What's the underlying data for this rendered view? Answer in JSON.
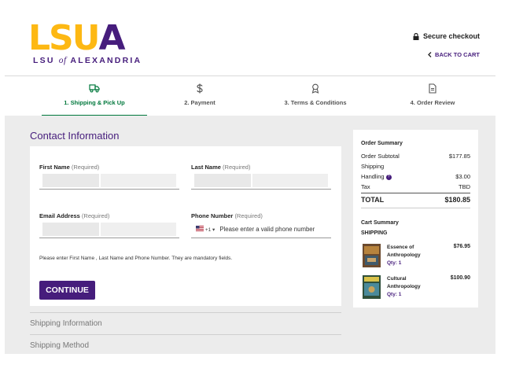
{
  "brand": {
    "logo_letters": [
      "L",
      "S",
      "U",
      "A"
    ],
    "logo_letter_colors": [
      "#fdb813",
      "#fdb813",
      "#fdb813",
      "#461d7c"
    ],
    "sub_left": "LSU",
    "sub_of": "of",
    "sub_right": "ALEXANDRIA",
    "primary_color": "#461d7c",
    "gold_color": "#fdb813",
    "success_color": "#00783c"
  },
  "header": {
    "secure_label": "Secure checkout",
    "secure_icon": "lock-icon",
    "back_label": "BACK TO CART",
    "back_icon": "chevron-left-icon"
  },
  "steps": [
    {
      "label": "1. Shipping & Pick Up",
      "icon": "truck-icon",
      "active": true
    },
    {
      "label": "2. Payment",
      "icon": "dollar-icon",
      "active": false
    },
    {
      "label": "3. Terms & Conditions",
      "icon": "ribbon-icon",
      "active": false
    },
    {
      "label": "4. Order Review",
      "icon": "document-icon",
      "active": false
    }
  ],
  "contact": {
    "title": "Contact Information",
    "first_name_label": "First Name",
    "last_name_label": "Last Name",
    "email_label": "Email Address",
    "phone_label": "Phone Number",
    "required_text": "(Required)",
    "phone_country_code": "+1",
    "phone_placeholder": "Please enter a valid phone number",
    "note": "Please enter First Name , Last Name and Phone Number. They are mandatory fields.",
    "continue_label": "CONTINUE"
  },
  "sections": {
    "shipping_information": "Shipping Information",
    "shipping_method": "Shipping Method"
  },
  "summary": {
    "title": "Order Summary",
    "rows": [
      {
        "label": "Order Subtotal",
        "value": "$177.85"
      },
      {
        "label": "Shipping",
        "value": ""
      },
      {
        "label": "Handling",
        "value": "$3.00"
      },
      {
        "label": "Tax",
        "value": "TBD"
      }
    ],
    "total_label": "TOTAL",
    "total_value": "$180.85",
    "cart_title": "Cart Summary",
    "shipping_title": "SHIPPING",
    "items": [
      {
        "name": "Essence of Anthropology",
        "qty": "Qty: 1",
        "price": "$76.95"
      },
      {
        "name": "Cultural Anthropology",
        "qty": "Qty: 1",
        "price": "$100.90"
      }
    ]
  }
}
